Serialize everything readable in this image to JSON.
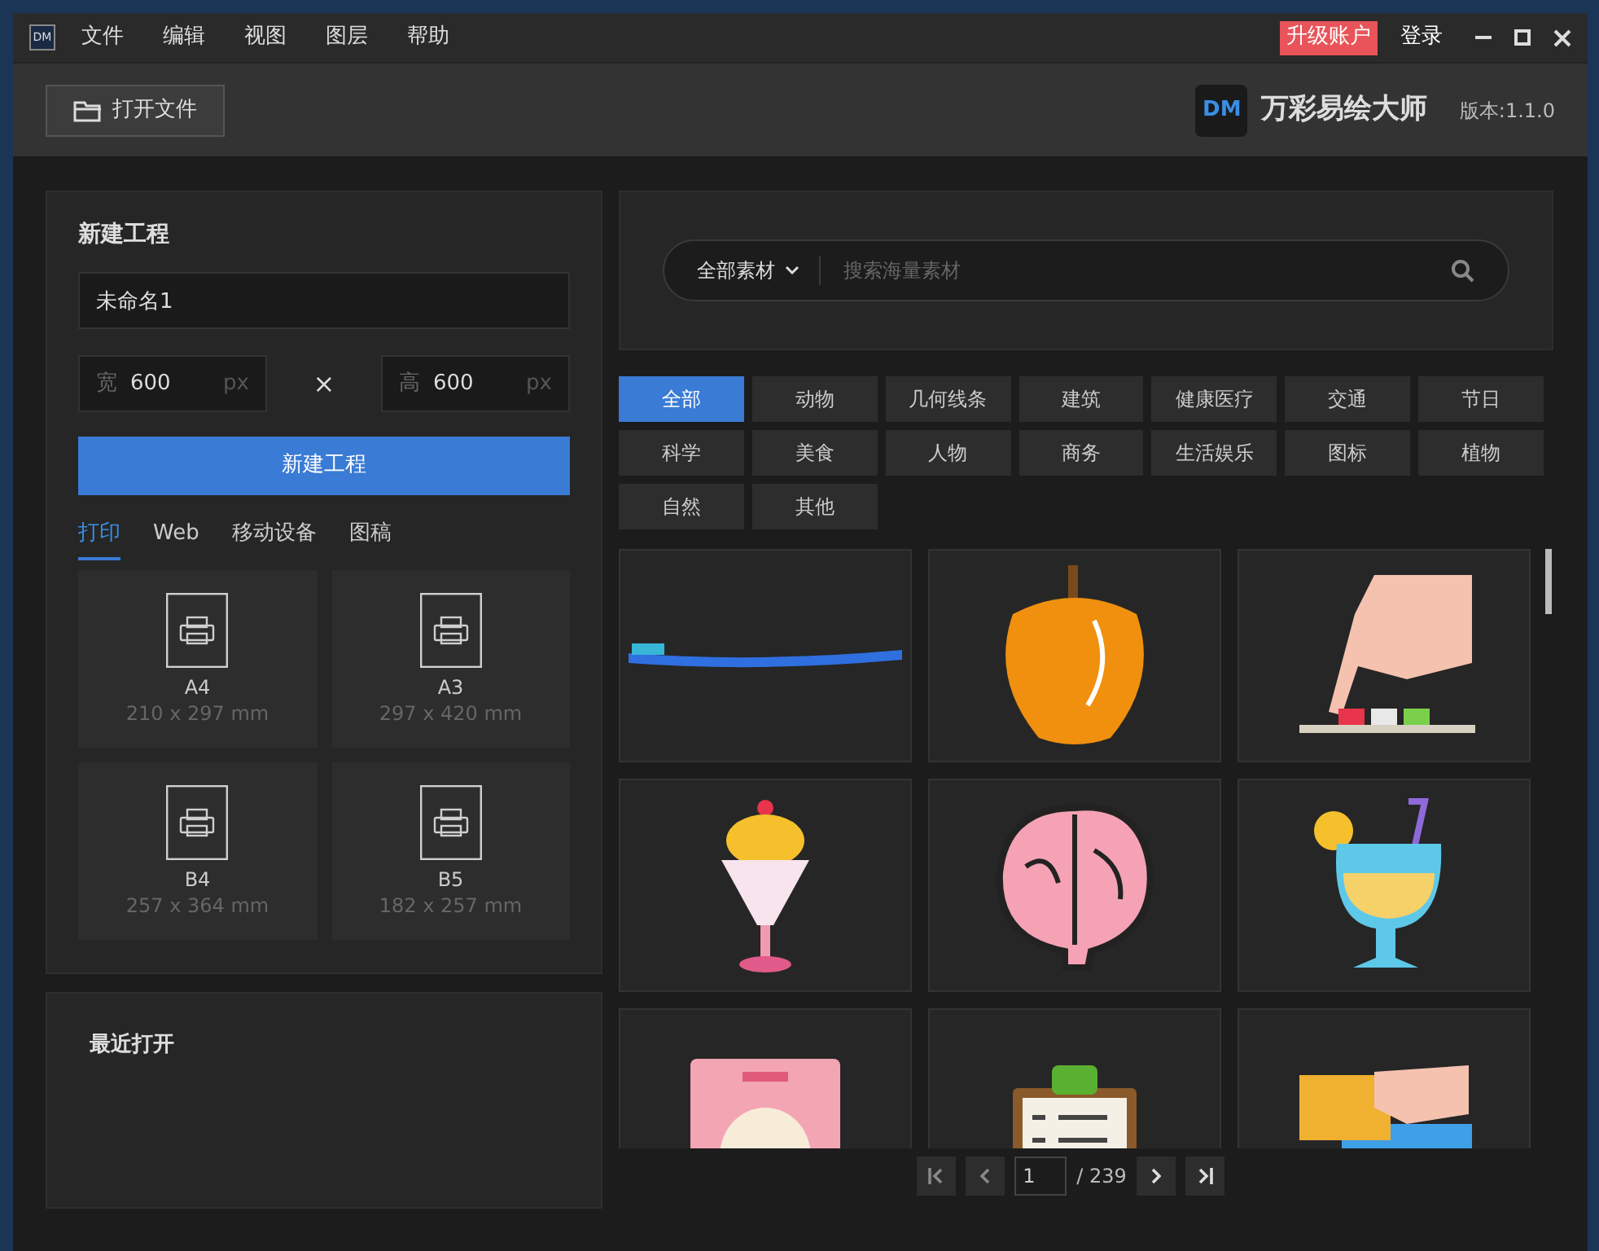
{
  "window": {
    "logo": "DM",
    "menu": [
      "文件",
      "编辑",
      "视图",
      "图层",
      "帮助"
    ],
    "upgrade": "升级账户",
    "login": "登录"
  },
  "toolbar": {
    "open_file": "打开文件",
    "brand_logo": "DM",
    "brand_name": "万彩易绘大师",
    "version": "版本:1.1.0"
  },
  "new_project": {
    "title": "新建工程",
    "name_value": "未命名1",
    "width_label": "宽",
    "width_value": "600",
    "width_unit": "px",
    "times": "×",
    "height_label": "高",
    "height_value": "600",
    "height_unit": "px",
    "create_button": "新建工程",
    "tabs": [
      {
        "label": "打印",
        "selected": true
      },
      {
        "label": "Web",
        "selected": false
      },
      {
        "label": "移动设备",
        "selected": false
      },
      {
        "label": "图稿",
        "selected": false
      }
    ],
    "presets": [
      {
        "name": "A4",
        "size": "210 x 297 mm"
      },
      {
        "name": "A3",
        "size": "297 x 420 mm"
      },
      {
        "name": "B4",
        "size": "257 x 364 mm"
      },
      {
        "name": "B5",
        "size": "182 x 257 mm"
      }
    ]
  },
  "recent": {
    "title": "最近打开"
  },
  "search": {
    "scope": "全部素材",
    "placeholder": "搜索海量素材"
  },
  "categories": [
    {
      "label": "全部",
      "selected": true
    },
    {
      "label": "动物",
      "selected": false
    },
    {
      "label": "几何线条",
      "selected": false
    },
    {
      "label": "建筑",
      "selected": false
    },
    {
      "label": "健康医疗",
      "selected": false
    },
    {
      "label": "交通",
      "selected": false
    },
    {
      "label": "节日",
      "selected": false
    },
    {
      "label": "科学",
      "selected": false
    },
    {
      "label": "美食",
      "selected": false
    },
    {
      "label": "人物",
      "selected": false
    },
    {
      "label": "商务",
      "selected": false
    },
    {
      "label": "生活娱乐",
      "selected": false
    },
    {
      "label": "图标",
      "selected": false
    },
    {
      "label": "植物",
      "selected": false
    },
    {
      "label": "自然",
      "selected": false
    },
    {
      "label": "其他",
      "selected": false
    }
  ],
  "assets": [
    {
      "kind": "toothbrush"
    },
    {
      "kind": "pepper"
    },
    {
      "kind": "hand"
    },
    {
      "kind": "sundae"
    },
    {
      "kind": "brain"
    },
    {
      "kind": "cocktail"
    },
    {
      "kind": "card"
    },
    {
      "kind": "clipboard"
    },
    {
      "kind": "payment"
    }
  ],
  "pagination": {
    "page": "1",
    "total": "/ 239"
  }
}
